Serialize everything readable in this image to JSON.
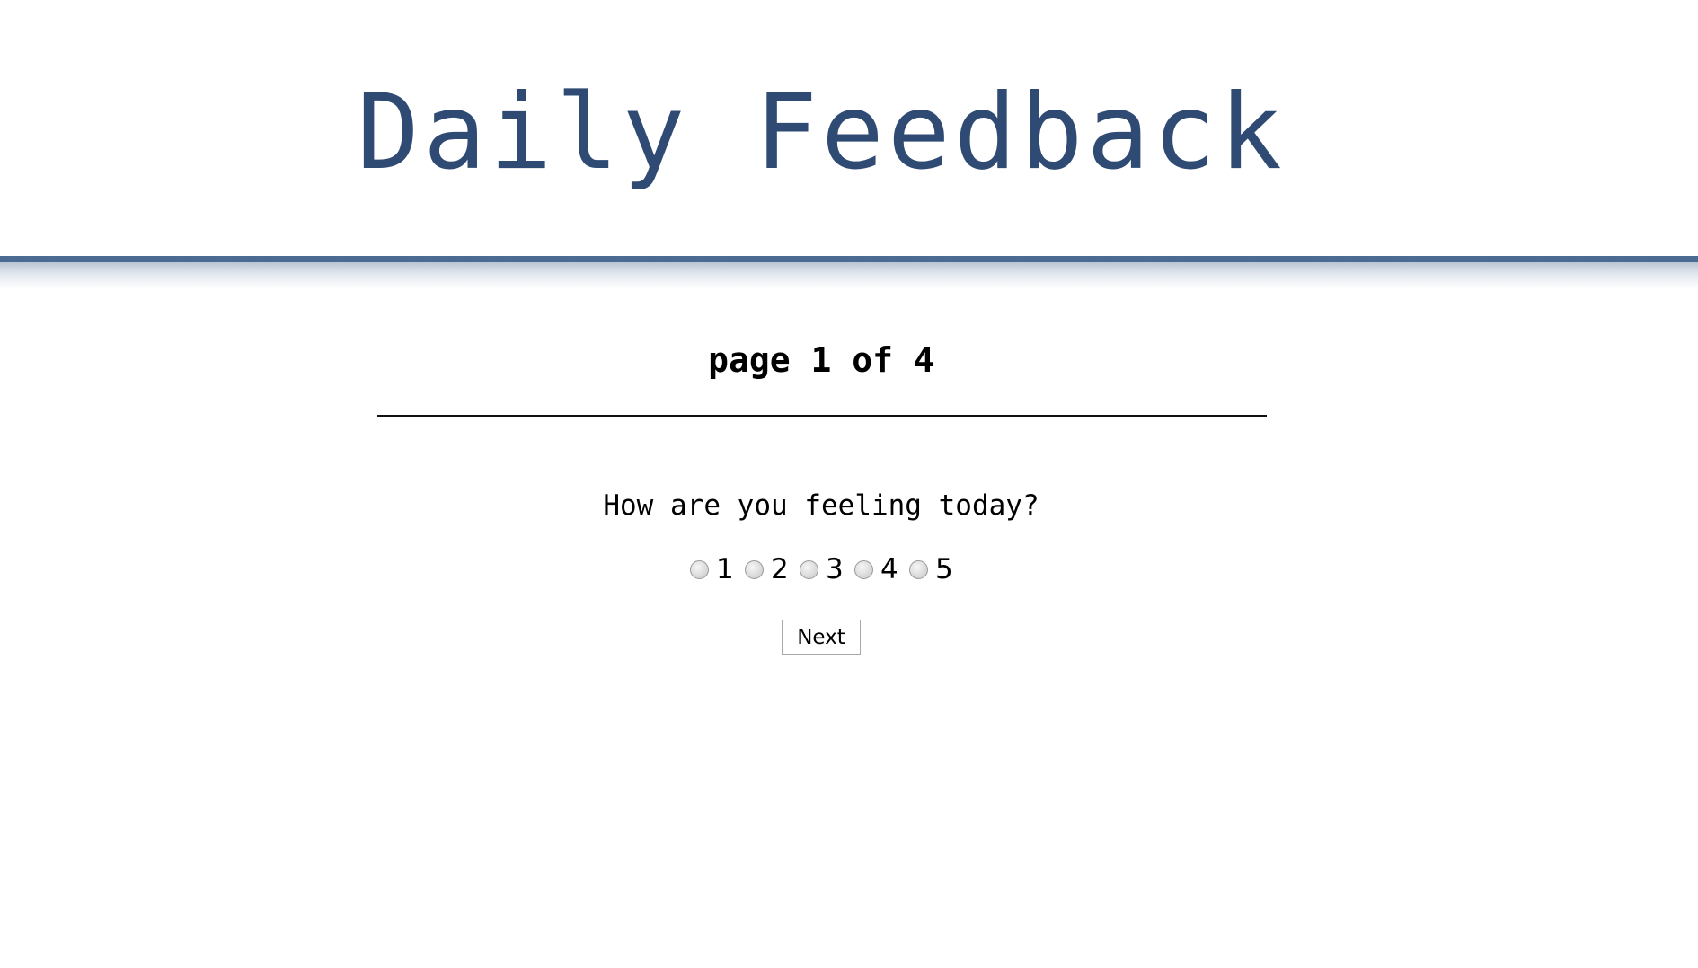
{
  "header": {
    "title": "Daily Feedback",
    "bar_color": "#4c6b92",
    "title_color": "#2f4b74"
  },
  "survey": {
    "page_indicator": "page 1 of 4",
    "question": "How are you feeling today?",
    "rating_options": [
      {
        "label": "1",
        "selected": false
      },
      {
        "label": "2",
        "selected": false
      },
      {
        "label": "3",
        "selected": false
      },
      {
        "label": "4",
        "selected": false
      },
      {
        "label": "5",
        "selected": false
      }
    ],
    "next_label": "Next"
  }
}
